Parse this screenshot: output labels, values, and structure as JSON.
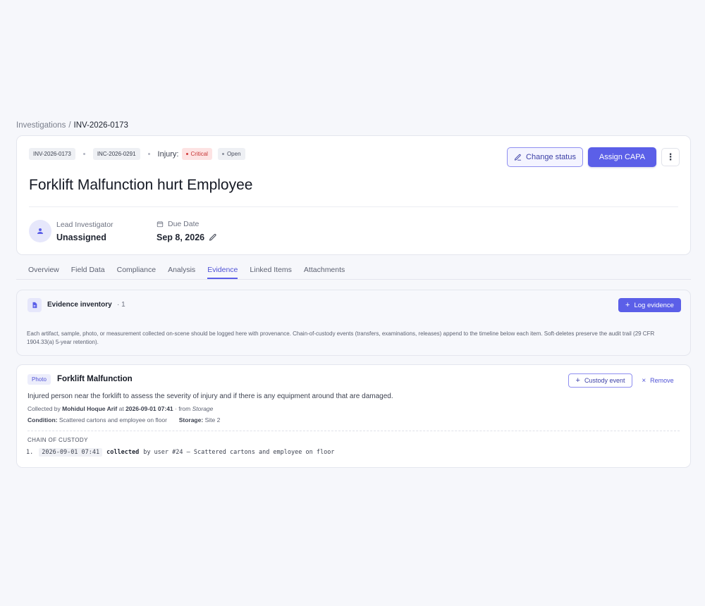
{
  "breadcrumb": {
    "root": "Investigations",
    "separator": "/",
    "current": "INV-2026-0173"
  },
  "header": {
    "investigation_id": "INV-2026-0173",
    "incident_id": "INC-2026-0291",
    "injury_label": "Injury:",
    "severity": "Critical",
    "status": "Open",
    "title": "Forklift Malfunction hurt Employee",
    "change_status_label": "Change status",
    "assign_capa_label": "Assign CAPA",
    "more_label": "⋮",
    "lead_investigator_label": "Lead Investigator",
    "lead_investigator_value": "Unassigned",
    "due_date_label": "Due Date",
    "due_date_value": "Sep 8, 2026"
  },
  "tabs": [
    {
      "label": "Overview"
    },
    {
      "label": "Field Data"
    },
    {
      "label": "Compliance"
    },
    {
      "label": "Analysis"
    },
    {
      "label": "Evidence"
    },
    {
      "label": "Linked Items"
    },
    {
      "label": "Attachments"
    }
  ],
  "active_tab": "Evidence",
  "inventory": {
    "title": "Evidence inventory",
    "count": "· 1",
    "log_button": "Log evidence",
    "description": "Each artifact, sample, photo, or measurement collected on-scene should be logged here with provenance. Chain-of-custody events (transfers, examinations, releases) append to the timeline below each item. Soft-deletes preserve the audit trail (29 CFR 1904.33(a) 5-year retention)."
  },
  "evidence_item": {
    "type_badge": "Photo",
    "title": "Forklift Malfunction",
    "custody_button": "Custody event",
    "remove_button": "Remove",
    "description": "Injured person near the forklift to assess the severity of injury and if there is any equipment around that are damaged.",
    "collected_prefix": "Collected by",
    "collected_by": "Mohidul Hoque Arif",
    "collected_at_prefix": "at",
    "collected_at": "2026-09-01 07:41",
    "from_prefix": "· from",
    "from": "Storage",
    "condition_label": "Condition:",
    "condition_value": "Scattered cartons and employee on floor",
    "storage_label": "Storage:",
    "storage_value": "Site 2",
    "chain_heading": "CHAIN OF CUSTODY",
    "chain": [
      {
        "number": "1.",
        "timestamp": "2026-09-01 07:41",
        "action": "collected",
        "detail": "by user #24 — Scattered cartons and employee on floor"
      }
    ]
  },
  "colors": {
    "accent": "#5b5fe8",
    "critical_bg": "#fde3e3",
    "critical_text": "#c63434",
    "background": "#f6f7fb"
  },
  "icons": {
    "change_status": "pencil-icon",
    "avatar": "user-icon",
    "due_date": "calendar-icon",
    "due_edit": "pencil-icon",
    "inventory": "document-icon",
    "log": "plus-icon",
    "custody": "plus-icon",
    "remove": "close-icon",
    "more": "more-vertical-icon"
  }
}
